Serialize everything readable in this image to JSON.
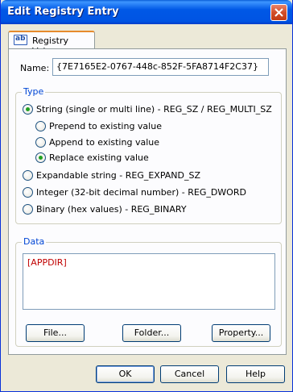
{
  "window": {
    "title": "Edit Registry Entry"
  },
  "tab": {
    "icon": "ab",
    "label": "Registry Value"
  },
  "name": {
    "label": "Name:",
    "value": "{7E7165E2-0767-448c-852F-5FA8714F2C37}"
  },
  "type_group": {
    "legend": "Type",
    "options": [
      {
        "label": "String (single or multi line) - REG_SZ / REG_MULTI_SZ",
        "checked": true
      },
      {
        "label": "Prepend to existing value",
        "checked": false
      },
      {
        "label": "Append to existing value",
        "checked": false
      },
      {
        "label": "Replace existing value",
        "checked": true
      },
      {
        "label": "Expandable string - REG_EXPAND_SZ",
        "checked": false
      },
      {
        "label": "Integer (32-bit decimal number) - REG_DWORD",
        "checked": false
      },
      {
        "label": "Binary (hex values) - REG_BINARY",
        "checked": false
      }
    ]
  },
  "data_group": {
    "legend": "Data",
    "value": "[APPDIR]",
    "file_button": "File...",
    "folder_button": "Folder...",
    "property_button": "Property..."
  },
  "footer": {
    "ok": "OK",
    "cancel": "Cancel",
    "help": "Help"
  }
}
